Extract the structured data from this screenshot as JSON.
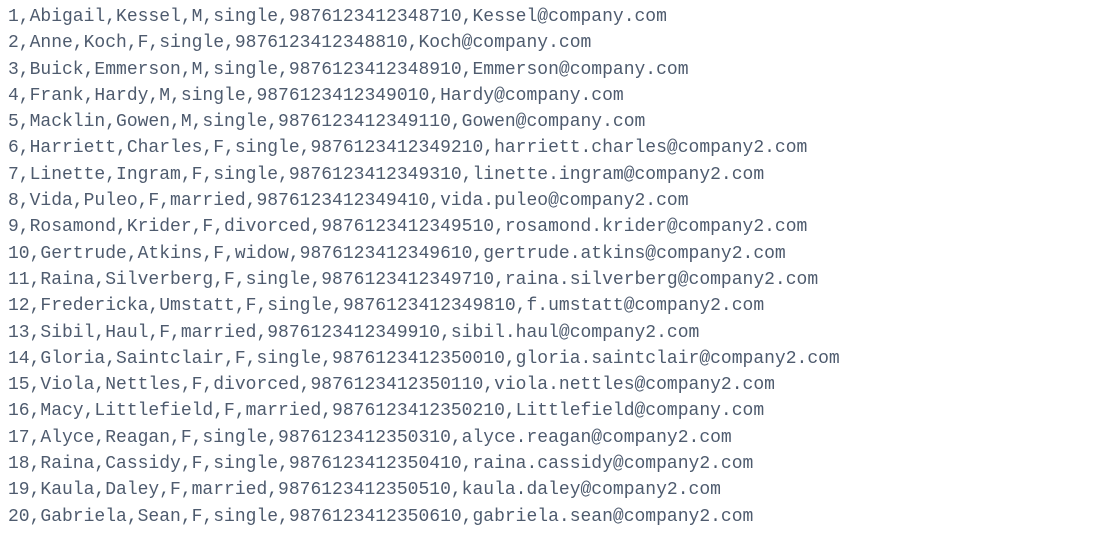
{
  "text_color": "#4e5b6e",
  "rows": [
    {
      "id": "1",
      "first": "Abigail",
      "last": "Kessel",
      "sex": "M",
      "status": "single",
      "phone": "9876123412348710",
      "email": "Kessel@company.com"
    },
    {
      "id": "2",
      "first": "Anne",
      "last": "Koch",
      "sex": "F",
      "status": "single",
      "phone": "9876123412348810",
      "email": "Koch@company.com"
    },
    {
      "id": "3",
      "first": "Buick",
      "last": "Emmerson",
      "sex": "M",
      "status": "single",
      "phone": "9876123412348910",
      "email": "Emmerson@company.com"
    },
    {
      "id": "4",
      "first": "Frank",
      "last": "Hardy",
      "sex": "M",
      "status": "single",
      "phone": "9876123412349010",
      "email": "Hardy@company.com"
    },
    {
      "id": "5",
      "first": "Macklin",
      "last": "Gowen",
      "sex": "M",
      "status": "single",
      "phone": "9876123412349110",
      "email": "Gowen@company.com"
    },
    {
      "id": "6",
      "first": "Harriett",
      "last": "Charles",
      "sex": "F",
      "status": "single",
      "phone": "9876123412349210",
      "email": "harriett.charles@company2.com"
    },
    {
      "id": "7",
      "first": "Linette",
      "last": "Ingram",
      "sex": "F",
      "status": "single",
      "phone": "9876123412349310",
      "email": "linette.ingram@company2.com"
    },
    {
      "id": "8",
      "first": "Vida",
      "last": "Puleo",
      "sex": "F",
      "status": "married",
      "phone": "9876123412349410",
      "email": "vida.puleo@company2.com"
    },
    {
      "id": "9",
      "first": "Rosamond",
      "last": "Krider",
      "sex": "F",
      "status": "divorced",
      "phone": "9876123412349510",
      "email": "rosamond.krider@company2.com"
    },
    {
      "id": "10",
      "first": "Gertrude",
      "last": "Atkins",
      "sex": "F",
      "status": "widow",
      "phone": "9876123412349610",
      "email": "gertrude.atkins@company2.com"
    },
    {
      "id": "11",
      "first": "Raina",
      "last": "Silverberg",
      "sex": "F",
      "status": "single",
      "phone": "9876123412349710",
      "email": "raina.silverberg@company2.com"
    },
    {
      "id": "12",
      "first": "Fredericka",
      "last": "Umstatt",
      "sex": "F",
      "status": "single",
      "phone": "9876123412349810",
      "email": "f.umstatt@company2.com"
    },
    {
      "id": "13",
      "first": "Sibil",
      "last": "Haul",
      "sex": "F",
      "status": "married",
      "phone": "9876123412349910",
      "email": "sibil.haul@company2.com"
    },
    {
      "id": "14",
      "first": "Gloria",
      "last": "Saintclair",
      "sex": "F",
      "status": "single",
      "phone": "9876123412350010",
      "email": "gloria.saintclair@company2.com"
    },
    {
      "id": "15",
      "first": "Viola",
      "last": "Nettles",
      "sex": "F",
      "status": "divorced",
      "phone": "9876123412350110",
      "email": "viola.nettles@company2.com"
    },
    {
      "id": "16",
      "first": "Macy",
      "last": "Littlefield",
      "sex": "F",
      "status": "married",
      "phone": "9876123412350210",
      "email": "Littlefield@company.com"
    },
    {
      "id": "17",
      "first": "Alyce",
      "last": "Reagan",
      "sex": "F",
      "status": "single",
      "phone": "9876123412350310",
      "email": "alyce.reagan@company2.com"
    },
    {
      "id": "18",
      "first": "Raina",
      "last": "Cassidy",
      "sex": "F",
      "status": "single",
      "phone": "9876123412350410",
      "email": "raina.cassidy@company2.com"
    },
    {
      "id": "19",
      "first": "Kaula",
      "last": "Daley",
      "sex": "F",
      "status": "married",
      "phone": "9876123412350510",
      "email": "kaula.daley@company2.com"
    },
    {
      "id": "20",
      "first": "Gabriela",
      "last": "Sean",
      "sex": "F",
      "status": "single",
      "phone": "9876123412350610",
      "email": "gabriela.sean@company2.com"
    }
  ]
}
